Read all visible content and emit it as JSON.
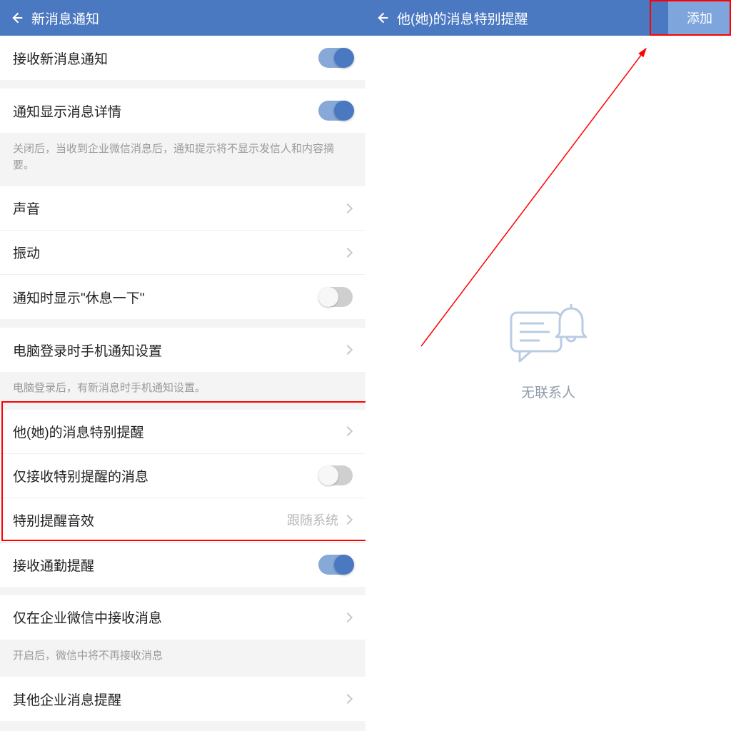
{
  "left": {
    "header": {
      "title": "新消息通知"
    },
    "rows": {
      "receive_new": {
        "label": "接收新消息通知",
        "toggle": "on"
      },
      "show_detail": {
        "label": "通知显示消息详情",
        "toggle": "on"
      },
      "show_detail_footer": "关闭后，当收到企业微信消息后，通知提示将不显示发信人和内容摘要。",
      "sound": {
        "label": "声音"
      },
      "vibrate": {
        "label": "振动"
      },
      "rest": {
        "label": "通知时显示\"休息一下\"",
        "toggle": "off"
      },
      "pc_login": {
        "label": "电脑登录时手机通知设置"
      },
      "pc_login_footer": "电脑登录后，有新消息时手机通知设置。",
      "special_remind": {
        "label": "他(她)的消息特别提醒"
      },
      "only_special": {
        "label": "仅接收特别提醒的消息",
        "toggle": "off"
      },
      "special_sound": {
        "label": "特别提醒音效",
        "value": "跟随系统"
      },
      "commute": {
        "label": "接收通勤提醒",
        "toggle": "on"
      },
      "only_in_app": {
        "label": "仅在企业微信中接收消息"
      },
      "only_in_app_footer": "开启后，微信中将不再接收消息",
      "other_corp": {
        "label": "其他企业消息提醒"
      }
    }
  },
  "right": {
    "header": {
      "title": "他(她)的消息特别提醒",
      "add": "添加"
    },
    "empty": "无联系人"
  }
}
